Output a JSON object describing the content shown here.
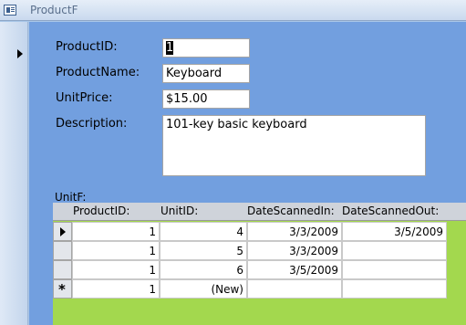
{
  "window": {
    "title": "ProductF"
  },
  "form": {
    "product_id_label": "ProductID:",
    "product_id_value": "1",
    "product_name_label": "ProductName:",
    "product_name_value": "Keyboard",
    "unit_price_label": "UnitPrice:",
    "unit_price_value": "$15.00",
    "description_label": "Description:",
    "description_value": "101-key basic keyboard"
  },
  "subform": {
    "label": "UnitF:",
    "columns": [
      "ProductID:",
      "UnitID:",
      "DateScannedIn:",
      "DateScannedOut:"
    ],
    "rows": [
      {
        "product_id": "1",
        "unit_id": "4",
        "date_in": "3/3/2009",
        "date_out": "3/5/2009"
      },
      {
        "product_id": "1",
        "unit_id": "5",
        "date_in": "3/3/2009",
        "date_out": ""
      },
      {
        "product_id": "1",
        "unit_id": "6",
        "date_in": "3/5/2009",
        "date_out": ""
      },
      {
        "product_id": "1",
        "unit_id": "(New)",
        "date_in": "",
        "date_out": ""
      }
    ]
  },
  "colors": {
    "form_bg": "#729fdf",
    "subform_bg": "#a3d84e"
  }
}
